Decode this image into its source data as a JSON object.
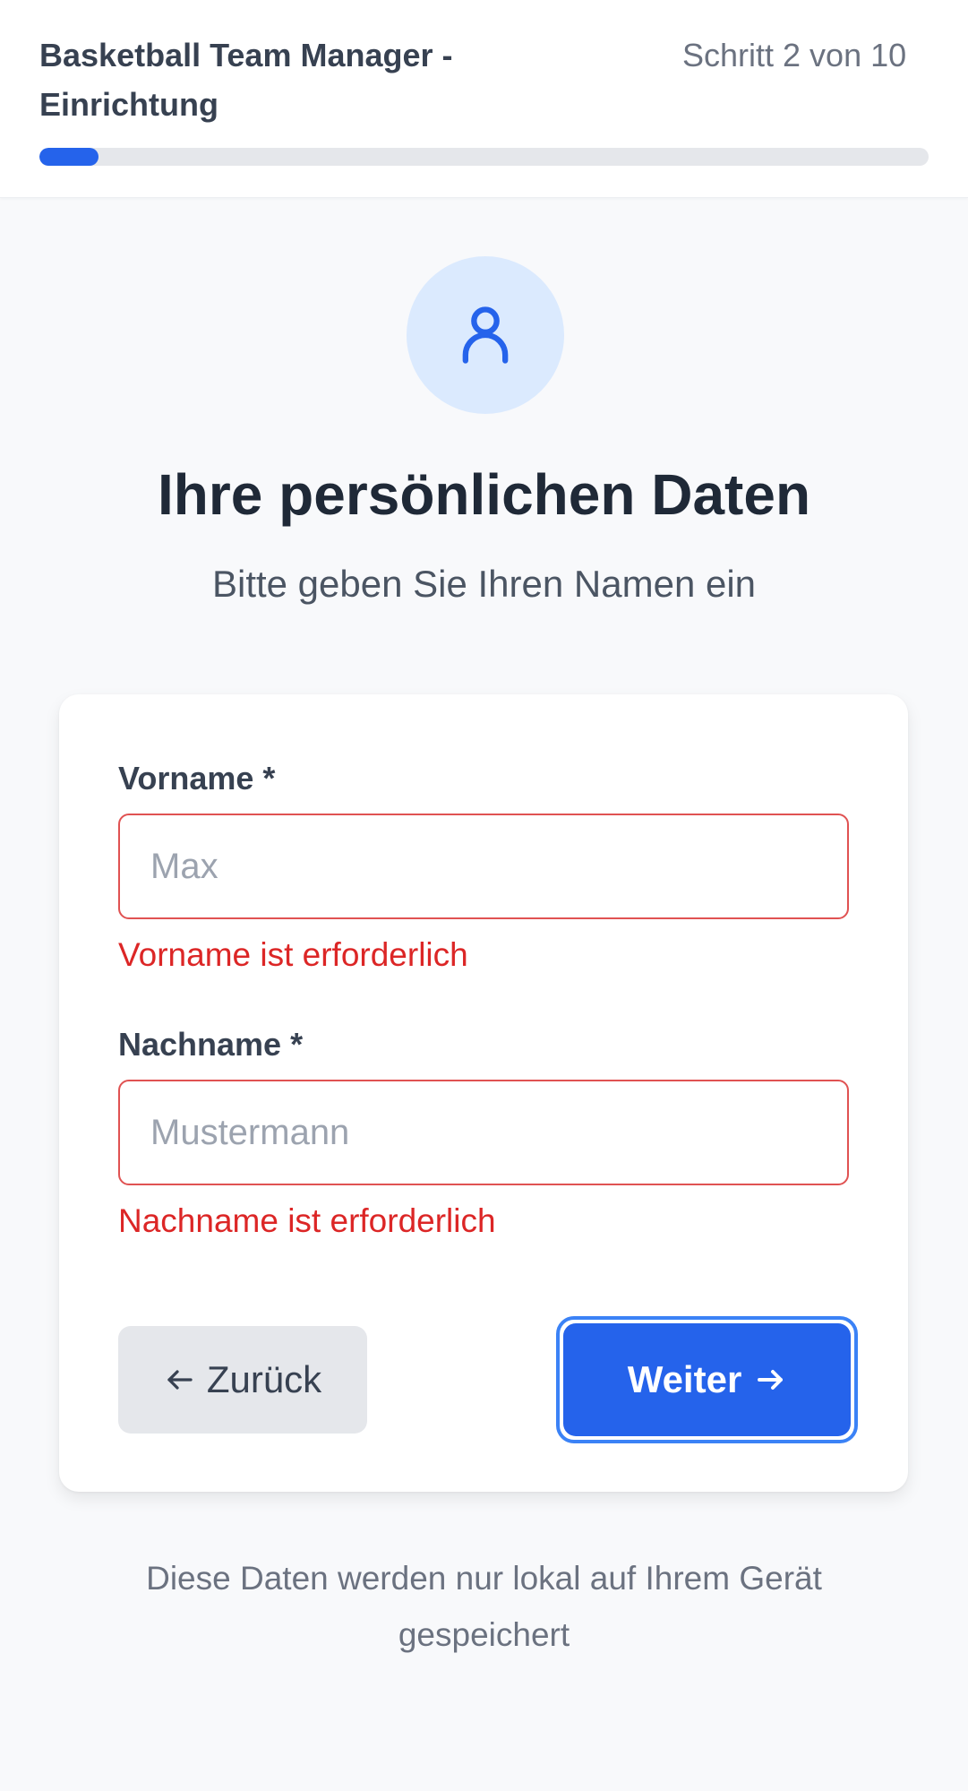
{
  "header": {
    "app_title": "Basketball Team Manager - Einrichtung",
    "step_label": "Schritt 2 von 10",
    "progress_percent": 6.6,
    "accent_color": "#2563eb"
  },
  "hero": {
    "icon": "user-icon",
    "title": "Ihre persönlichen Daten",
    "subtitle": "Bitte geben Sie Ihren Namen ein"
  },
  "form": {
    "first_name": {
      "label": "Vorname *",
      "placeholder": "Max",
      "value": "",
      "error": "Vorname ist erforderlich"
    },
    "last_name": {
      "label": "Nachname *",
      "placeholder": "Mustermann",
      "value": "",
      "error": "Nachname ist erforderlich"
    },
    "error_color": "#dc2626"
  },
  "actions": {
    "back_label": "Zurück",
    "back_icon": "arrow-left-icon",
    "next_label": "Weiter",
    "next_icon": "arrow-right-icon"
  },
  "footer": {
    "note": "Diese Daten werden nur lokal auf Ihrem Gerät gespeichert"
  }
}
